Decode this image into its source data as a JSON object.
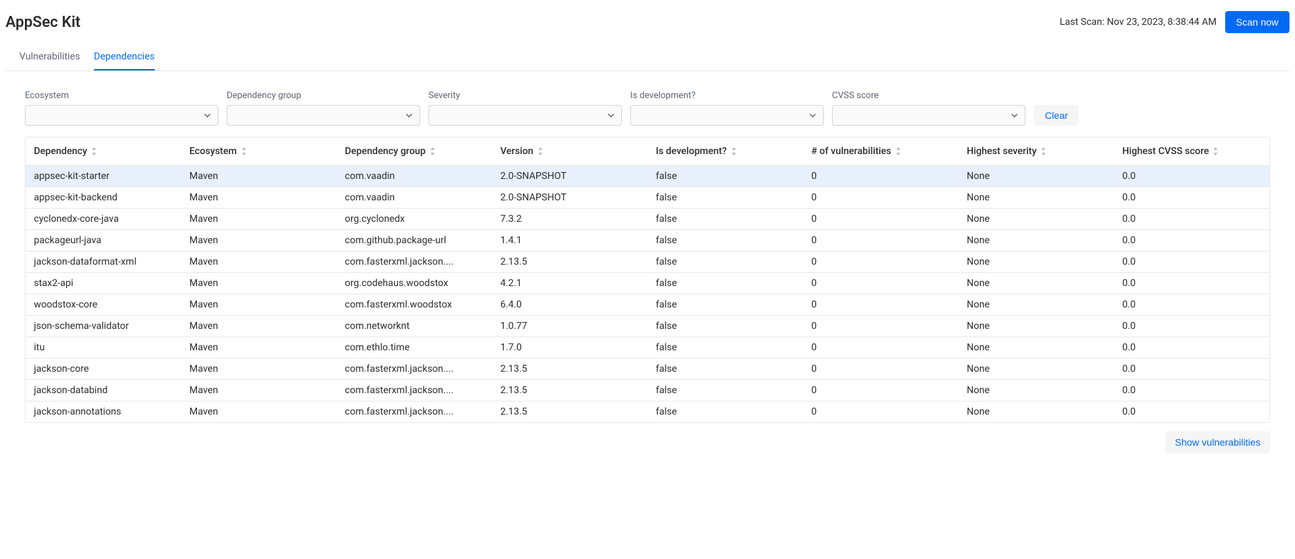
{
  "header": {
    "title": "AppSec Kit",
    "last_scan": "Last Scan: Nov 23, 2023, 8:38:44 AM",
    "scan_button": "Scan now"
  },
  "tabs": [
    {
      "label": "Vulnerabilities",
      "active": false
    },
    {
      "label": "Dependencies",
      "active": true
    }
  ],
  "filters": {
    "ecosystem": {
      "label": "Ecosystem"
    },
    "dependency_group": {
      "label": "Dependency group"
    },
    "severity": {
      "label": "Severity"
    },
    "is_development": {
      "label": "Is development?"
    },
    "cvss_score": {
      "label": "CVSS score"
    },
    "clear": "Clear"
  },
  "columns": {
    "dependency": "Dependency",
    "ecosystem": "Ecosystem",
    "dependency_group": "Dependency group",
    "version": "Version",
    "is_development": "Is development?",
    "num_vuln": "# of vulnerabilities",
    "highest_severity": "Highest severity",
    "highest_cvss": "Highest CVSS score"
  },
  "rows": [
    {
      "dependency": "appsec-kit-starter",
      "ecosystem": "Maven",
      "group": "com.vaadin",
      "version": "2.0-SNAPSHOT",
      "is_dev": "false",
      "vuln": "0",
      "severity": "None",
      "cvss": "0.0",
      "selected": true
    },
    {
      "dependency": "appsec-kit-backend",
      "ecosystem": "Maven",
      "group": "com.vaadin",
      "version": "2.0-SNAPSHOT",
      "is_dev": "false",
      "vuln": "0",
      "severity": "None",
      "cvss": "0.0"
    },
    {
      "dependency": "cyclonedx-core-java",
      "ecosystem": "Maven",
      "group": "org.cyclonedx",
      "version": "7.3.2",
      "is_dev": "false",
      "vuln": "0",
      "severity": "None",
      "cvss": "0.0"
    },
    {
      "dependency": "packageurl-java",
      "ecosystem": "Maven",
      "group": "com.github.package-url",
      "version": "1.4.1",
      "is_dev": "false",
      "vuln": "0",
      "severity": "None",
      "cvss": "0.0"
    },
    {
      "dependency": "jackson-dataformat-xml",
      "ecosystem": "Maven",
      "group": "com.fasterxml.jackson....",
      "version": "2.13.5",
      "is_dev": "false",
      "vuln": "0",
      "severity": "None",
      "cvss": "0.0"
    },
    {
      "dependency": "stax2-api",
      "ecosystem": "Maven",
      "group": "org.codehaus.woodstox",
      "version": "4.2.1",
      "is_dev": "false",
      "vuln": "0",
      "severity": "None",
      "cvss": "0.0"
    },
    {
      "dependency": "woodstox-core",
      "ecosystem": "Maven",
      "group": "com.fasterxml.woodstox",
      "version": "6.4.0",
      "is_dev": "false",
      "vuln": "0",
      "severity": "None",
      "cvss": "0.0"
    },
    {
      "dependency": "json-schema-validator",
      "ecosystem": "Maven",
      "group": "com.networknt",
      "version": "1.0.77",
      "is_dev": "false",
      "vuln": "0",
      "severity": "None",
      "cvss": "0.0"
    },
    {
      "dependency": "itu",
      "ecosystem": "Maven",
      "group": "com.ethlo.time",
      "version": "1.7.0",
      "is_dev": "false",
      "vuln": "0",
      "severity": "None",
      "cvss": "0.0"
    },
    {
      "dependency": "jackson-core",
      "ecosystem": "Maven",
      "group": "com.fasterxml.jackson....",
      "version": "2.13.5",
      "is_dev": "false",
      "vuln": "0",
      "severity": "None",
      "cvss": "0.0"
    },
    {
      "dependency": "jackson-databind",
      "ecosystem": "Maven",
      "group": "com.fasterxml.jackson....",
      "version": "2.13.5",
      "is_dev": "false",
      "vuln": "0",
      "severity": "None",
      "cvss": "0.0"
    },
    {
      "dependency": "jackson-annotations",
      "ecosystem": "Maven",
      "group": "com.fasterxml.jackson....",
      "version": "2.13.5",
      "is_dev": "false",
      "vuln": "0",
      "severity": "None",
      "cvss": "0.0"
    }
  ],
  "footer": {
    "show_vulnerabilities": "Show vulnerabilities"
  }
}
